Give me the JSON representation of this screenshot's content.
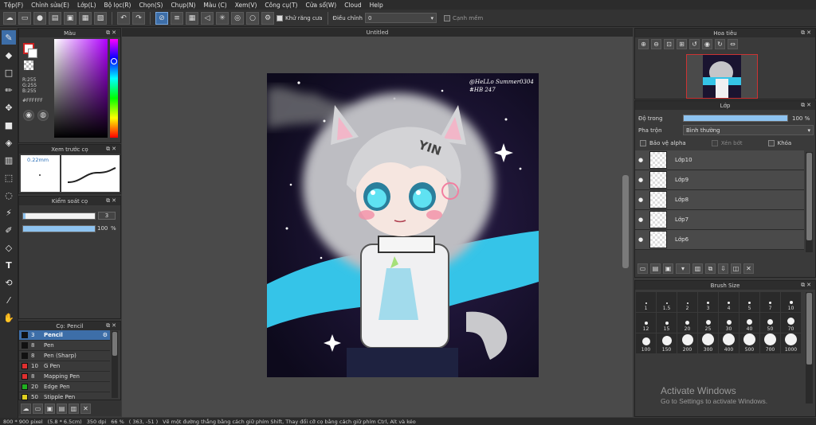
{
  "menu": [
    "Tệp(F)",
    "Chỉnh sửa(E)",
    "Lớp(L)",
    "Bộ lọc(R)",
    "Chọn(S)",
    "Chụp(N)",
    "Màu (C)",
    "Xem(V)",
    "Công cụ(T)",
    "Cửa sổ(W)",
    "Cloud",
    "Help"
  ],
  "toolbar": {
    "antialias_label": "Khử răng cưa",
    "correction_label": "Điều chỉnh",
    "correction_value": "0",
    "snap_label": "Cạnh mềm"
  },
  "color_panel": {
    "title": "Màu",
    "r": "R:255",
    "g": "G:255",
    "b": "B:255",
    "hex": "#FFFFFF",
    "fg_color": "#ffffff",
    "accent": "#cc2222"
  },
  "preview_panel": {
    "title": "Xem trước cọ",
    "size_text": "0.22mm"
  },
  "control_panel": {
    "title": "Kiểm soát cọ",
    "size_value": "3",
    "opacity_value": "100",
    "opacity_unit": "%"
  },
  "brush_panel": {
    "title": "Cọ: Pencil",
    "items": [
      {
        "size": "3",
        "name": "Pencil",
        "color": "#111111",
        "selected": true
      },
      {
        "size": "8",
        "name": "Pen",
        "color": "#111111"
      },
      {
        "size": "8",
        "name": "Pen (Sharp)",
        "color": "#111111"
      },
      {
        "size": "10",
        "name": "G Pen",
        "color": "#e03030"
      },
      {
        "size": "8",
        "name": "Mapping Pen",
        "color": "#e03030"
      },
      {
        "size": "20",
        "name": "Edge Pen",
        "color": "#20b020"
      },
      {
        "size": "50",
        "name": "Stipple Pen",
        "color": "#e0d020"
      }
    ]
  },
  "canvas": {
    "title": "Untitled",
    "signature_line1": "@HeLLo Summer0304",
    "signature_line2": "#HB 247",
    "cap_text": "YIN",
    "scroll_position": 0.45
  },
  "navigator": {
    "title": "Hoa tiêu"
  },
  "layers": {
    "title": "Lớp",
    "opacity_label": "Độ trong",
    "opacity_value": "100 %",
    "blend_label": "Pha trộn",
    "blend_value": "Bình thường",
    "protect_alpha": "Bảo vệ alpha",
    "clip": "Xén bớt",
    "lock": "Khóa",
    "items": [
      "Lớp10",
      "Lớp9",
      "Lớp8",
      "Lớp7",
      "Lớp6"
    ]
  },
  "brush_size": {
    "title": "Brush Size",
    "sizes": [
      "1",
      "1.5",
      "2",
      "3",
      "4",
      "5",
      "7",
      "10",
      "12",
      "15",
      "20",
      "25",
      "30",
      "40",
      "50",
      "70",
      "100",
      "150",
      "200",
      "300",
      "400",
      "500",
      "700",
      "1000"
    ]
  },
  "status": {
    "dims": "800 * 900 pixel",
    "physical": "(5.8 * 6.5cm)",
    "dpi": "350 dpi",
    "zoom": "66 %",
    "coords": "( 363, -51 )",
    "hint": "Vẽ một đường thẳng bằng cách giữ phím Shift, Thay đổi cỡ cọ bằng cách giữ phím Ctrl, Alt và kéo"
  },
  "watermark": {
    "line1": "Activate Windows",
    "line2": "Go to Settings to activate Windows."
  }
}
